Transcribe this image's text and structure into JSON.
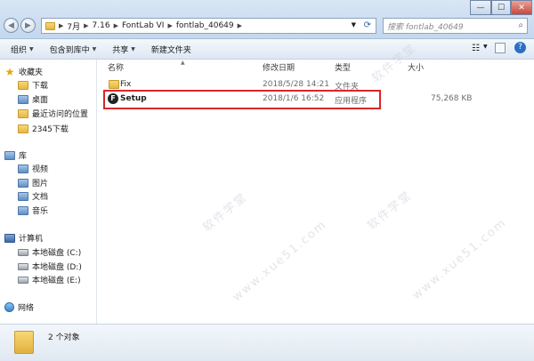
{
  "window": {
    "address_crumbs": [
      "7月",
      "7.16",
      "FontLab VI",
      "fontlab_40649"
    ],
    "search_placeholder": "搜索 fontlab_40649",
    "buttons": {
      "min": "—",
      "max": "☐",
      "close": "✕"
    }
  },
  "toolbar": {
    "organize": "组织",
    "include_in_library": "包含到库中",
    "share": "共享",
    "new_folder": "新建文件夹"
  },
  "nav": {
    "favorites": {
      "label": "收藏夹",
      "items": [
        "下载",
        "桌面",
        "最近访问的位置"
      ]
    },
    "extra": "2345下载",
    "libraries": {
      "label": "库",
      "items": [
        "视频",
        "图片",
        "文档",
        "音乐"
      ]
    },
    "computer": {
      "label": "计算机",
      "items": [
        "本地磁盘 (C:)",
        "本地磁盘 (D:)",
        "本地磁盘 (E:)"
      ]
    },
    "network": "网络"
  },
  "columns": {
    "name": "名称",
    "modified": "修改日期",
    "type": "类型",
    "size": "大小"
  },
  "files": [
    {
      "name": "Fix",
      "modified": "2018/5/28 14:21",
      "type": "文件夹",
      "size": "",
      "icon": "folder-icon"
    },
    {
      "name": "Setup",
      "modified": "2018/1/6 16:52",
      "type": "应用程序",
      "size": "75,268 KB",
      "icon": "fontlab-app-icon"
    }
  ],
  "status": {
    "count": "2 个对象"
  },
  "watermark": {
    "text_cn": "软件学堂",
    "text_url": "www.xue51.com"
  },
  "colors": {
    "highlight": "#d9262b",
    "titlebar": "#c4d7ee"
  }
}
